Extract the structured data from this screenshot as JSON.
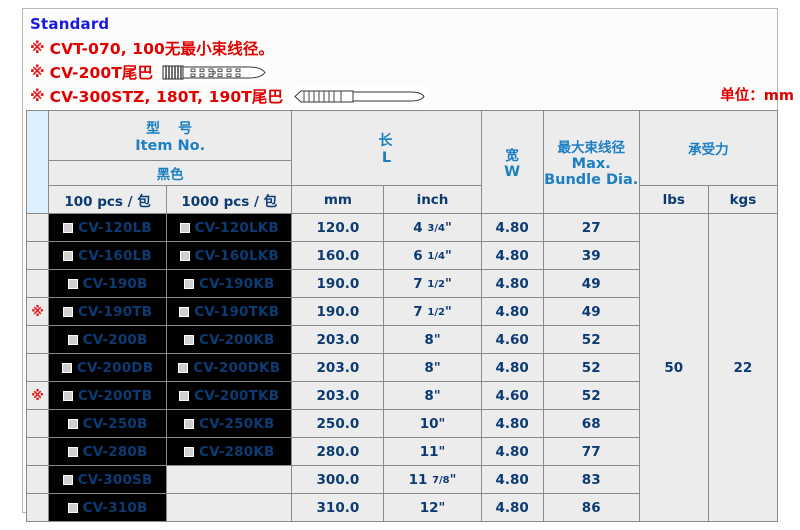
{
  "notes": {
    "standard_label": "Standard",
    "star_symbol": "※",
    "line1": "CVT-070, 100无最小束线径。",
    "line2": "CV-200T尾巴",
    "line3": "CV-300STZ, 180T, 190T尾巴",
    "unit_note": "单位：mm"
  },
  "table": {
    "headers": {
      "item_no_cn": "型　号",
      "item_no_en": "Item No.",
      "color_cn": "黑色",
      "pack_100": "100 pcs / 包",
      "pack_1000": "1000 pcs / 包",
      "length_cn": "长",
      "length_en": "L",
      "length_mm": "mm",
      "length_inch": "inch",
      "width_cn": "宽",
      "width_en": "W",
      "bundle_cn": "最大束线径",
      "bundle_en1": "Max.",
      "bundle_en2": "Bundle Dia.",
      "force_cn": "承受力",
      "force_lbs": "lbs",
      "force_kgs": "kgs"
    },
    "force": {
      "lbs": "50",
      "kgs": "22"
    },
    "rows": [
      {
        "star": "",
        "item_100": "CV-120LB",
        "item_1000": "CV-120LKB",
        "mm": "120.0",
        "inch_whole": "4",
        "inch_frac": "3/4",
        "inch_mark": "\"",
        "w": "4.80",
        "bundle": "27"
      },
      {
        "star": "",
        "item_100": "CV-160LB",
        "item_1000": "CV-160LKB",
        "mm": "160.0",
        "inch_whole": "6",
        "inch_frac": "1/4",
        "inch_mark": "\"",
        "w": "4.80",
        "bundle": "39"
      },
      {
        "star": "",
        "item_100": "CV-190B",
        "item_1000": "CV-190KB",
        "mm": "190.0",
        "inch_whole": "7",
        "inch_frac": "1/2",
        "inch_mark": "\"",
        "w": "4.80",
        "bundle": "49"
      },
      {
        "star": "※",
        "item_100": "CV-190TB",
        "item_1000": "CV-190TKB",
        "mm": "190.0",
        "inch_whole": "7",
        "inch_frac": "1/2",
        "inch_mark": "\"",
        "w": "4.80",
        "bundle": "49"
      },
      {
        "star": "",
        "item_100": "CV-200B",
        "item_1000": "CV-200KB",
        "mm": "203.0",
        "inch_whole": "8",
        "inch_frac": "",
        "inch_mark": "\"",
        "w": "4.60",
        "bundle": "52"
      },
      {
        "star": "",
        "item_100": "CV-200DB",
        "item_1000": "CV-200DKB",
        "mm": "203.0",
        "inch_whole": "8",
        "inch_frac": "",
        "inch_mark": "\"",
        "w": "4.80",
        "bundle": "52"
      },
      {
        "star": "※",
        "item_100": "CV-200TB",
        "item_1000": "CV-200TKB",
        "mm": "203.0",
        "inch_whole": "8",
        "inch_frac": "",
        "inch_mark": "\"",
        "w": "4.60",
        "bundle": "52"
      },
      {
        "star": "",
        "item_100": "CV-250B",
        "item_1000": "CV-250KB",
        "mm": "250.0",
        "inch_whole": "10",
        "inch_frac": "",
        "inch_mark": "\"",
        "w": "4.80",
        "bundle": "68"
      },
      {
        "star": "",
        "item_100": "CV-280B",
        "item_1000": "CV-280KB",
        "mm": "280.0",
        "inch_whole": "11",
        "inch_frac": "",
        "inch_mark": "\"",
        "w": "4.80",
        "bundle": "77"
      },
      {
        "star": "",
        "item_100": "CV-300SB",
        "item_1000": "",
        "mm": "300.0",
        "inch_whole": "11",
        "inch_frac": "7/8",
        "inch_mark": "\"",
        "w": "4.80",
        "bundle": "83"
      },
      {
        "star": "",
        "item_100": "CV-310B",
        "item_1000": "",
        "mm": "310.0",
        "inch_whole": "12",
        "inch_frac": "",
        "inch_mark": "\"",
        "w": "4.80",
        "bundle": "86"
      }
    ]
  },
  "colors": {
    "note_red": "#e00000",
    "standard_blue": "#1a1ad8",
    "header_blue": "#1b7fc4",
    "header_bg": "#ddeefc",
    "data_blue": "#0c3b73",
    "cell_bg": "#ececec",
    "item_bg": "#000000"
  }
}
